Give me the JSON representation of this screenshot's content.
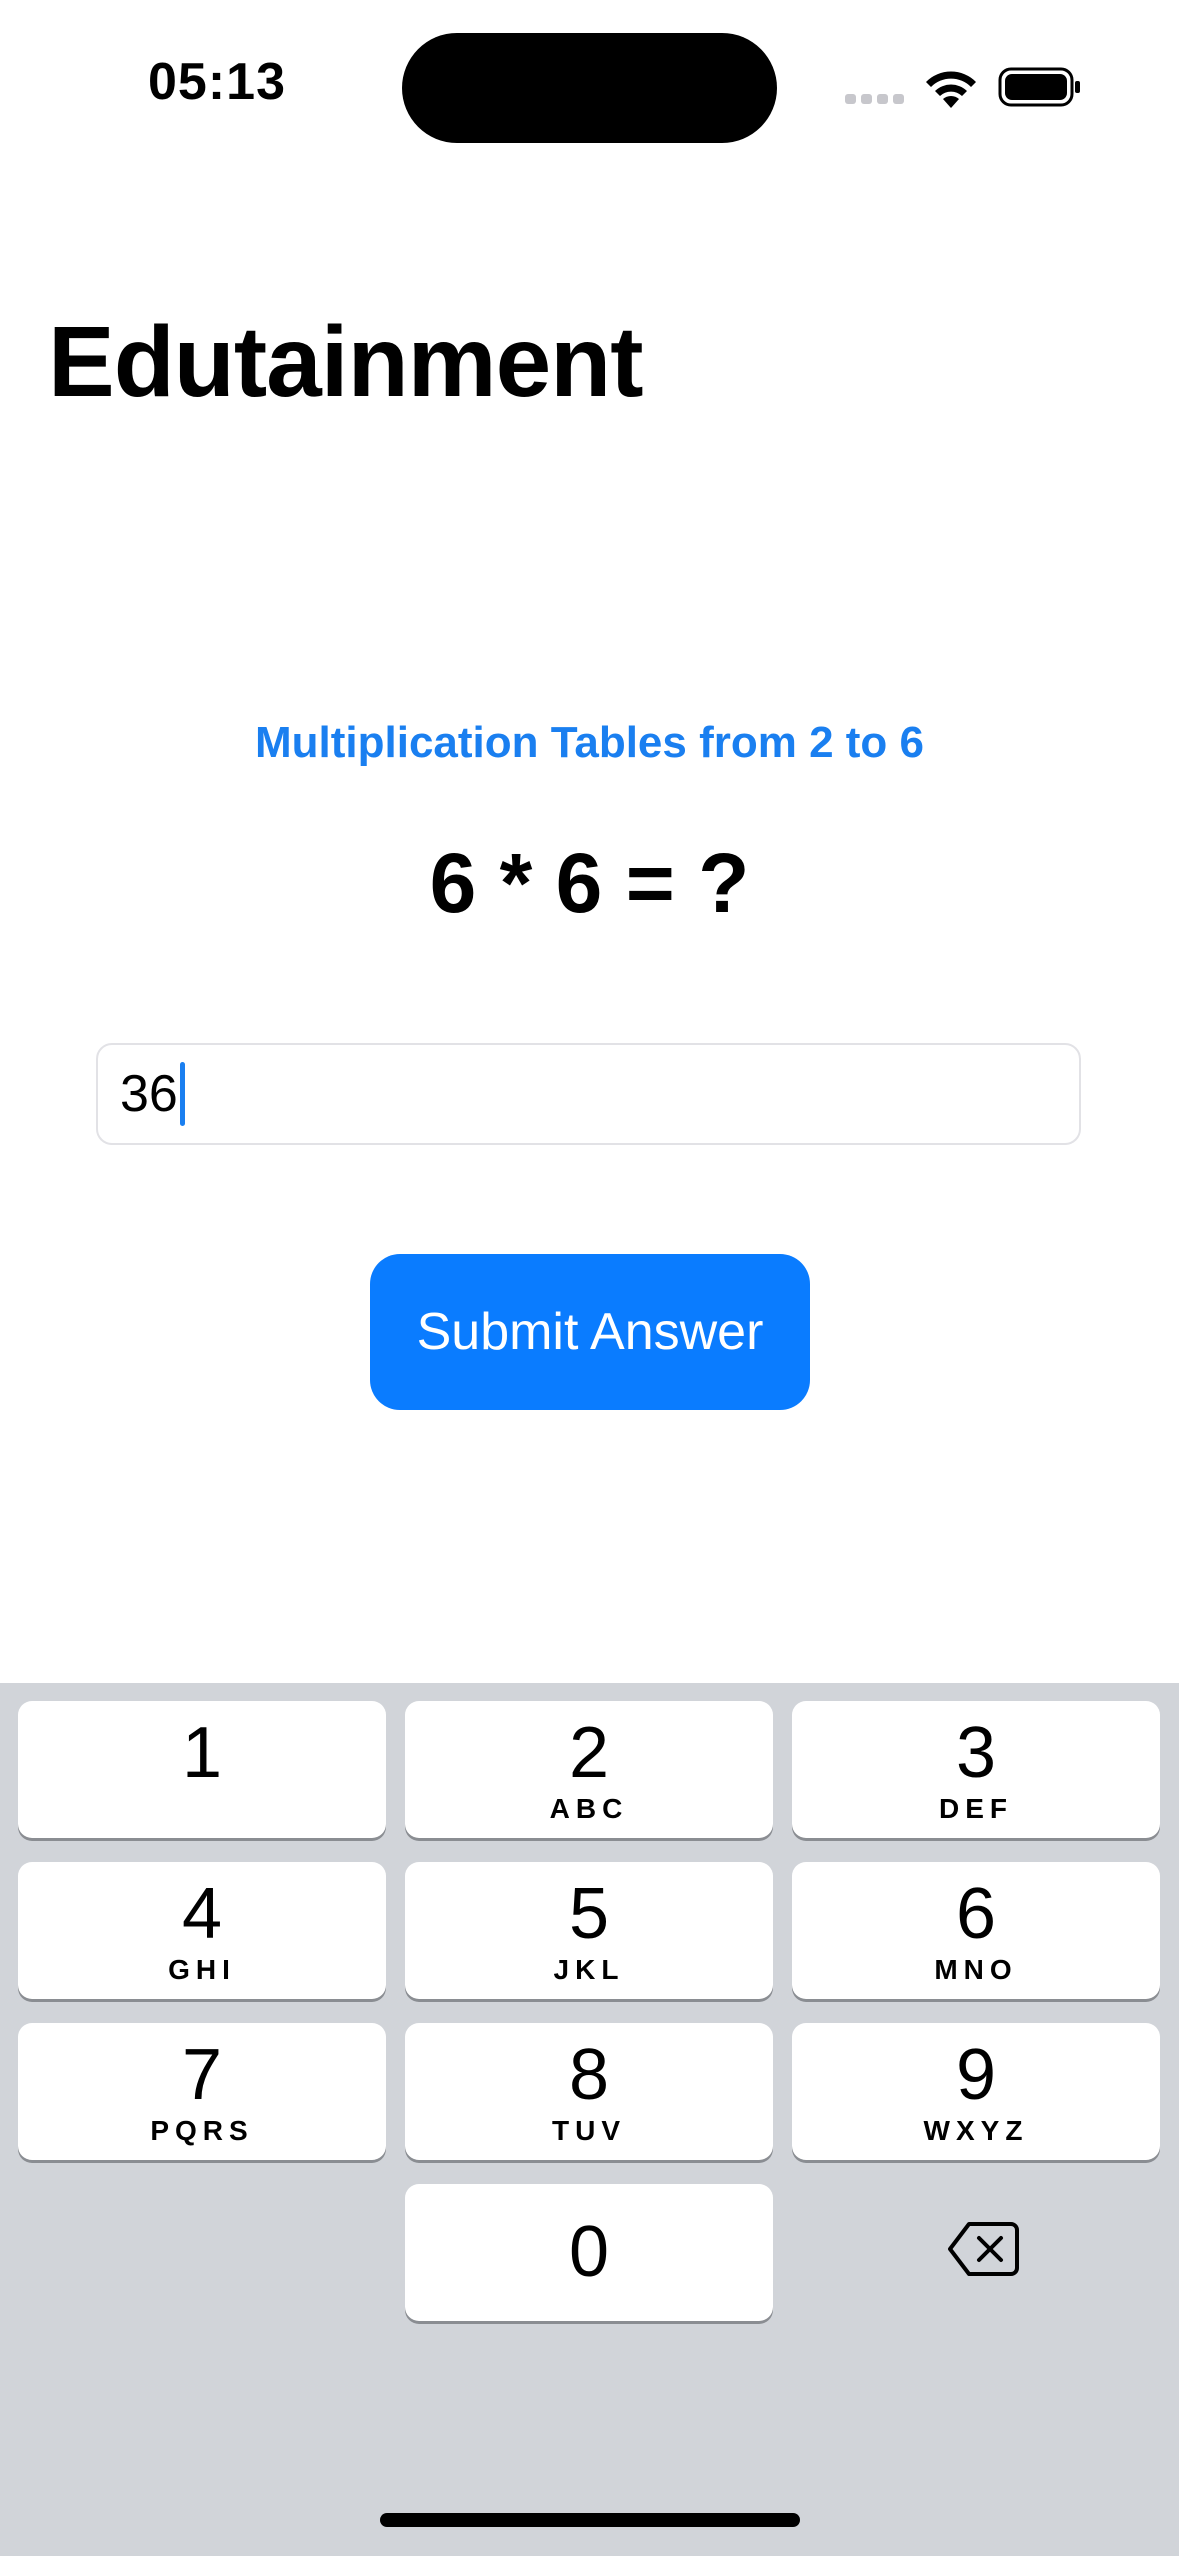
{
  "status_bar": {
    "time": "05:13"
  },
  "nav": {
    "title": "Edutainment"
  },
  "game": {
    "subtitle": "Multiplication Tables from 2 to 6",
    "question": "6 * 6 = ?",
    "answer_value": "36",
    "submit_label": "Submit Answer"
  },
  "keyboard": {
    "keys": [
      {
        "digit": "1",
        "letters": ""
      },
      {
        "digit": "2",
        "letters": "ABC"
      },
      {
        "digit": "3",
        "letters": "DEF"
      },
      {
        "digit": "4",
        "letters": "GHI"
      },
      {
        "digit": "5",
        "letters": "JKL"
      },
      {
        "digit": "6",
        "letters": "MNO"
      },
      {
        "digit": "7",
        "letters": "PQRS"
      },
      {
        "digit": "8",
        "letters": "TUV"
      },
      {
        "digit": "9",
        "letters": "WXYZ"
      },
      {
        "digit": "0",
        "letters": ""
      }
    ],
    "delete_icon": "delete-backspace-icon"
  },
  "colors": {
    "accent": "#0a7cff",
    "subtitle": "#1a7ff0",
    "keyboard_bg": "#d1d4d9"
  }
}
